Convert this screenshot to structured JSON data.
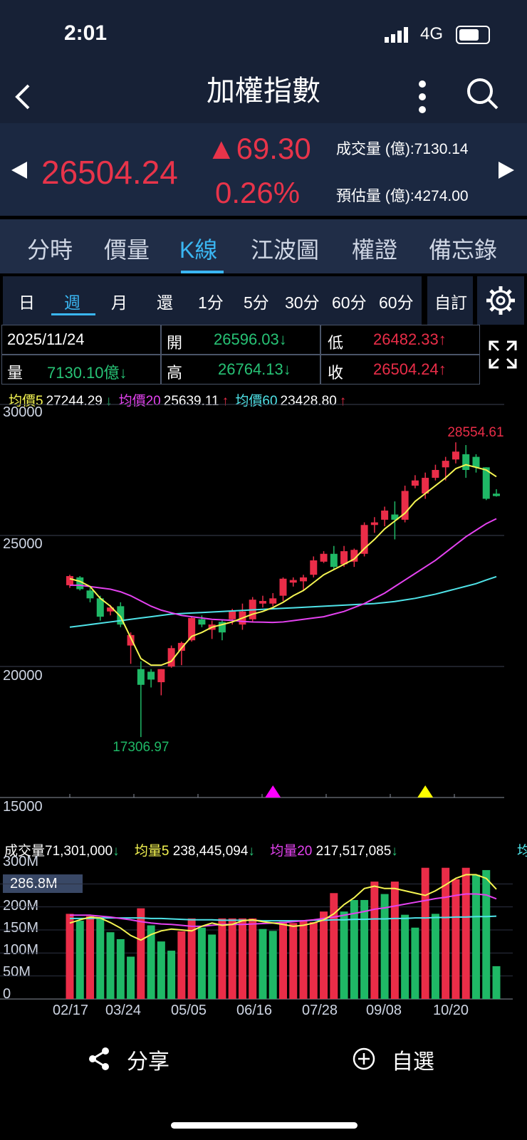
{
  "status": {
    "time": "2:01",
    "network": "4G",
    "battery_level": 0.7
  },
  "nav": {
    "title": "加權指數",
    "back_icon": "chevron-left-icon",
    "more_icon": "more-vertical-icon",
    "search_icon": "search-icon"
  },
  "quote": {
    "price": "26504.24",
    "change": "▲69.30",
    "percent": "0.26%",
    "volume_label": "成交量 (億):7130.14",
    "estimate_label": "預估量 (億):4274.00",
    "color_up": "#e8344a"
  },
  "tabs": [
    "分時",
    "價量",
    "K線",
    "江波圖",
    "權證",
    "備忘錄"
  ],
  "active_tab": "K線",
  "periods": [
    "日",
    "週",
    "月",
    "還",
    "1分",
    "5分",
    "30分",
    "60分",
    "60分"
  ],
  "active_period": "週",
  "custom_label": "自訂",
  "ohlc": {
    "date": "2025/11/24",
    "open_label": "開",
    "open": "26596.03↓",
    "low_label": "低",
    "low": "26482.33↑",
    "vol_label": "量",
    "vol": "7130.10億↓",
    "high_label": "高",
    "high": "26764.13↓",
    "close_label": "收",
    "close": "26504.24↑"
  },
  "ma_legend": {
    "ma5_label": "均價5",
    "ma5_value": "27244.29",
    "ma5_arrow": "↓",
    "ma20_label": "均價20",
    "ma20_value": "25639.11",
    "ma20_arrow": "↑",
    "ma60_label": "均價60",
    "ma60_value": "23428.80",
    "ma60_arrow": "↑"
  },
  "volume_legend": {
    "vol_label": "成交量",
    "vol_value": "71,301,000",
    "vol_arrow": "↓",
    "vma5_label": "均量5",
    "vma5_value": "238,445,094",
    "vma5_arrow": "↓",
    "vma20_label": "均量20",
    "vma20_value": "217,517,085",
    "vma20_arrow": "↓",
    "cut_label": "均"
  },
  "chart_data": [
    {
      "type": "candlestick",
      "y_ticks": [
        "30000",
        "25000",
        "20000",
        "15000"
      ],
      "ylim": [
        15000,
        30000
      ],
      "high_label": "28554.61",
      "low_label": "17306.97",
      "candles": [
        {
          "o": 23100,
          "h": 23500,
          "l": 23000,
          "c": 23450
        },
        {
          "o": 23400,
          "h": 23450,
          "l": 22900,
          "c": 22950
        },
        {
          "o": 22900,
          "h": 23000,
          "l": 22450,
          "c": 22600
        },
        {
          "o": 22600,
          "h": 22700,
          "l": 21750,
          "c": 21900
        },
        {
          "o": 22100,
          "h": 22350,
          "l": 21950,
          "c": 22250
        },
        {
          "o": 22300,
          "h": 22450,
          "l": 21500,
          "c": 21600
        },
        {
          "o": 20800,
          "h": 21300,
          "l": 20100,
          "c": 21200
        },
        {
          "o": 19900,
          "h": 20200,
          "l": 17306.97,
          "c": 19300
        },
        {
          "o": 19800,
          "h": 19900,
          "l": 19200,
          "c": 19500
        },
        {
          "o": 19400,
          "h": 19900,
          "l": 18900,
          "c": 19900
        },
        {
          "o": 20000,
          "h": 20800,
          "l": 19950,
          "c": 20700
        },
        {
          "o": 20600,
          "h": 20950,
          "l": 20050,
          "c": 20900
        },
        {
          "o": 21000,
          "h": 21900,
          "l": 20950,
          "c": 21850
        },
        {
          "o": 21800,
          "h": 21950,
          "l": 21500,
          "c": 21600
        },
        {
          "o": 21400,
          "h": 21750,
          "l": 21050,
          "c": 21600
        },
        {
          "o": 21700,
          "h": 21800,
          "l": 21000,
          "c": 21300
        },
        {
          "o": 21800,
          "h": 22200,
          "l": 21600,
          "c": 22100
        },
        {
          "o": 21600,
          "h": 22400,
          "l": 21400,
          "c": 22100
        },
        {
          "o": 21800,
          "h": 22650,
          "l": 21700,
          "c": 22550
        },
        {
          "o": 22400,
          "h": 22700,
          "l": 22250,
          "c": 22500
        },
        {
          "o": 22400,
          "h": 22800,
          "l": 22300,
          "c": 22600
        },
        {
          "o": 22700,
          "h": 23400,
          "l": 22500,
          "c": 23350
        },
        {
          "o": 23200,
          "h": 23400,
          "l": 23050,
          "c": 23300
        },
        {
          "o": 23250,
          "h": 23500,
          "l": 22900,
          "c": 23400
        },
        {
          "o": 23500,
          "h": 24200,
          "l": 23400,
          "c": 24050
        },
        {
          "o": 24000,
          "h": 24400,
          "l": 23950,
          "c": 24300
        },
        {
          "o": 24300,
          "h": 24600,
          "l": 23700,
          "c": 23800
        },
        {
          "o": 23900,
          "h": 24600,
          "l": 23800,
          "c": 24400
        },
        {
          "o": 24000,
          "h": 24500,
          "l": 23800,
          "c": 24450
        },
        {
          "o": 24300,
          "h": 25500,
          "l": 24200,
          "c": 25400
        },
        {
          "o": 25400,
          "h": 25700,
          "l": 25100,
          "c": 25500
        },
        {
          "o": 25600,
          "h": 26100,
          "l": 25350,
          "c": 25950
        },
        {
          "o": 25800,
          "h": 26300,
          "l": 24850,
          "c": 25600
        },
        {
          "o": 25600,
          "h": 26900,
          "l": 25500,
          "c": 26700
        },
        {
          "o": 26900,
          "h": 27300,
          "l": 26800,
          "c": 27100
        },
        {
          "o": 26600,
          "h": 27400,
          "l": 26400,
          "c": 27200
        },
        {
          "o": 27200,
          "h": 27700,
          "l": 27100,
          "c": 27500
        },
        {
          "o": 27600,
          "h": 28000,
          "l": 27100,
          "c": 27850
        },
        {
          "o": 27900,
          "h": 28554.61,
          "l": 27750,
          "c": 28200
        },
        {
          "o": 28100,
          "h": 28450,
          "l": 27200,
          "c": 27500
        },
        {
          "o": 28000,
          "h": 28100,
          "l": 27400,
          "c": 27600
        },
        {
          "o": 27600,
          "h": 27600,
          "l": 26350,
          "c": 26400
        },
        {
          "o": 26596.03,
          "h": 26764.13,
          "l": 26482.33,
          "c": 26504.24
        }
      ],
      "ma5": [
        23350,
        23250,
        23050,
        22600,
        22300,
        21900,
        21100,
        20300,
        20050,
        20050,
        20200,
        20700,
        21150,
        21300,
        21500,
        21600,
        21700,
        21850,
        22000,
        22100,
        22250,
        22450,
        22700,
        22900,
        23200,
        23500,
        23700,
        23900,
        24100,
        24500,
        24850,
        25250,
        25550,
        25850,
        26300,
        26600,
        26900,
        27200,
        27550,
        27700,
        27600,
        27500,
        27244.29
      ],
      "ma20": [
        23100,
        23100,
        23050,
        23000,
        22950,
        22850,
        22700,
        22500,
        22300,
        22150,
        22050,
        21950,
        21900,
        21850,
        21800,
        21780,
        21760,
        21720,
        21700,
        21690,
        21680,
        21700,
        21750,
        21800,
        21850,
        21900,
        22000,
        22100,
        22250,
        22400,
        22600,
        22800,
        23050,
        23300,
        23550,
        23800,
        24050,
        24350,
        24650,
        24950,
        25200,
        25450,
        25639.11
      ],
      "ma60": [
        21500,
        21550,
        21600,
        21650,
        21700,
        21750,
        21800,
        21850,
        21900,
        21950,
        22000,
        22020,
        22040,
        22060,
        22080,
        22100,
        22120,
        22140,
        22160,
        22180,
        22200,
        22220,
        22240,
        22260,
        22280,
        22300,
        22320,
        22340,
        22360,
        22380,
        22400,
        22440,
        22480,
        22540,
        22600,
        22680,
        22760,
        22860,
        22960,
        23060,
        23160,
        23300,
        23428.8
      ],
      "markers": [
        {
          "index": 20,
          "color": "#ff00ff"
        },
        {
          "index": 35,
          "color": "#ffff00"
        }
      ]
    },
    {
      "type": "bar",
      "y_ticks": [
        "300M",
        "250M",
        "200M",
        "150M",
        "100M",
        "50M",
        "0"
      ],
      "ylim": [
        0,
        300
      ],
      "highlight_label": "286.8M",
      "x_ticks": [
        "02/17",
        "03/24",
        "05/05",
        "06/16",
        "07/28",
        "09/08",
        "10/20"
      ],
      "volumes": [
        185,
        170,
        180,
        175,
        145,
        130,
        92,
        197,
        160,
        125,
        105,
        147,
        175,
        155,
        140,
        175,
        175,
        175,
        175,
        152,
        148,
        168,
        165,
        170,
        167,
        190,
        230,
        190,
        215,
        215,
        255,
        228,
        255,
        183,
        155,
        285,
        185,
        285,
        260,
        285,
        270,
        280,
        71.3
      ],
      "up": [
        1,
        0,
        1,
        0,
        0,
        0,
        0,
        1,
        0,
        0,
        0,
        1,
        1,
        0,
        0,
        1,
        1,
        1,
        1,
        0,
        0,
        1,
        1,
        1,
        1,
        1,
        1,
        0,
        0,
        0,
        1,
        0,
        1,
        0,
        0,
        1,
        0,
        1,
        1,
        1,
        0,
        0,
        0
      ],
      "vma5": [
        165,
        172,
        178,
        176,
        166,
        154,
        138,
        128,
        140,
        148,
        152,
        150,
        148,
        158,
        165,
        160,
        162,
        170,
        172,
        168,
        165,
        162,
        158,
        160,
        165,
        172,
        185,
        205,
        220,
        240,
        245,
        240,
        240,
        235,
        230,
        225,
        235,
        248,
        262,
        270,
        270,
        262,
        238.4
      ],
      "vma20": [
        182,
        182,
        182,
        180,
        178,
        175,
        172,
        168,
        165,
        163,
        162,
        160,
        158,
        158,
        160,
        162,
        162,
        162,
        163,
        164,
        165,
        166,
        168,
        170,
        172,
        175,
        178,
        182,
        186,
        190,
        195,
        198,
        202,
        206,
        210,
        214,
        218,
        221,
        225,
        228,
        228,
        226,
        217.5
      ],
      "vma60": [
        175,
        175,
        175,
        176,
        176,
        176,
        176,
        176,
        175,
        175,
        174,
        173,
        172,
        172,
        172,
        171,
        171,
        171,
        171,
        170,
        170,
        170,
        170,
        170,
        171,
        171,
        172,
        172,
        173,
        173,
        174,
        174,
        175,
        175,
        176,
        176,
        177,
        177,
        178,
        178,
        179,
        179,
        180
      ],
      "legend": [
        "成交量",
        "均量5",
        "均量20"
      ]
    }
  ],
  "bottom": {
    "share_label": "分享",
    "watch_label": "自選",
    "share_icon": "share-icon",
    "add_icon": "plus-circle-icon"
  },
  "colors": {
    "up": "#ea2d48",
    "down": "#1fb866",
    "ma5": "#f5f552",
    "ma20": "#e442f0",
    "ma60": "#4fe3e8",
    "accent": "#3ab6f2"
  }
}
